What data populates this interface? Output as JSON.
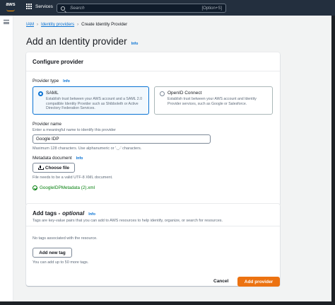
{
  "topbar": {
    "logo_text": "aws",
    "services_label": "Services",
    "search_placeholder": "Search",
    "search_shortcut": "[Option+S]"
  },
  "breadcrumb": {
    "items": [
      "IAM",
      "Identity providers",
      "Create Identity Provider"
    ]
  },
  "page": {
    "title": "Add an Identity provider",
    "info_label": "Info"
  },
  "configure": {
    "header": "Configure provider",
    "provider_type_label": "Provider type",
    "info_label": "Info",
    "options": [
      {
        "title": "SAML",
        "description": "Establish trust between your AWS account and a SAML 2.0 compatible Identity Provider such as Shibboleth or Active Directory Federation Services.",
        "selected": true
      },
      {
        "title": "OpenID Connect",
        "description": "Establish trust between your AWS account and Identity Provider services, such as Google or Salesforce.",
        "selected": false
      }
    ],
    "provider_name_label": "Provider name",
    "provider_name_hint": "Enter a meaningful name to identify this provider",
    "provider_name_value": "Google IDP",
    "provider_name_constraint": "Maximum 128 characters. Use alphanumeric or '._-' characters.",
    "metadata_label": "Metadata document",
    "metadata_info": "Info",
    "choose_file_label": "Choose file",
    "metadata_constraint": "File needs to be a valid UTF-8 XML document.",
    "uploaded_file": "GoogleIDPMetadata (2).xml"
  },
  "tags": {
    "header": "Add tags - ",
    "header_optional": "optional",
    "info_label": "Info",
    "description": "Tags are key-value pairs that you can add to AWS resources to help identify, organize, or search for resources.",
    "empty_text": "No tags associated with the resource.",
    "add_button": "Add new tag",
    "limit_text": "You can add up to 50 more tags."
  },
  "footer": {
    "cancel_label": "Cancel",
    "submit_label": "Add provider"
  },
  "colors": {
    "accent": "#0972d3",
    "primary_button": "#ec7211",
    "success": "#037f0c",
    "navbar": "#232f3e"
  }
}
